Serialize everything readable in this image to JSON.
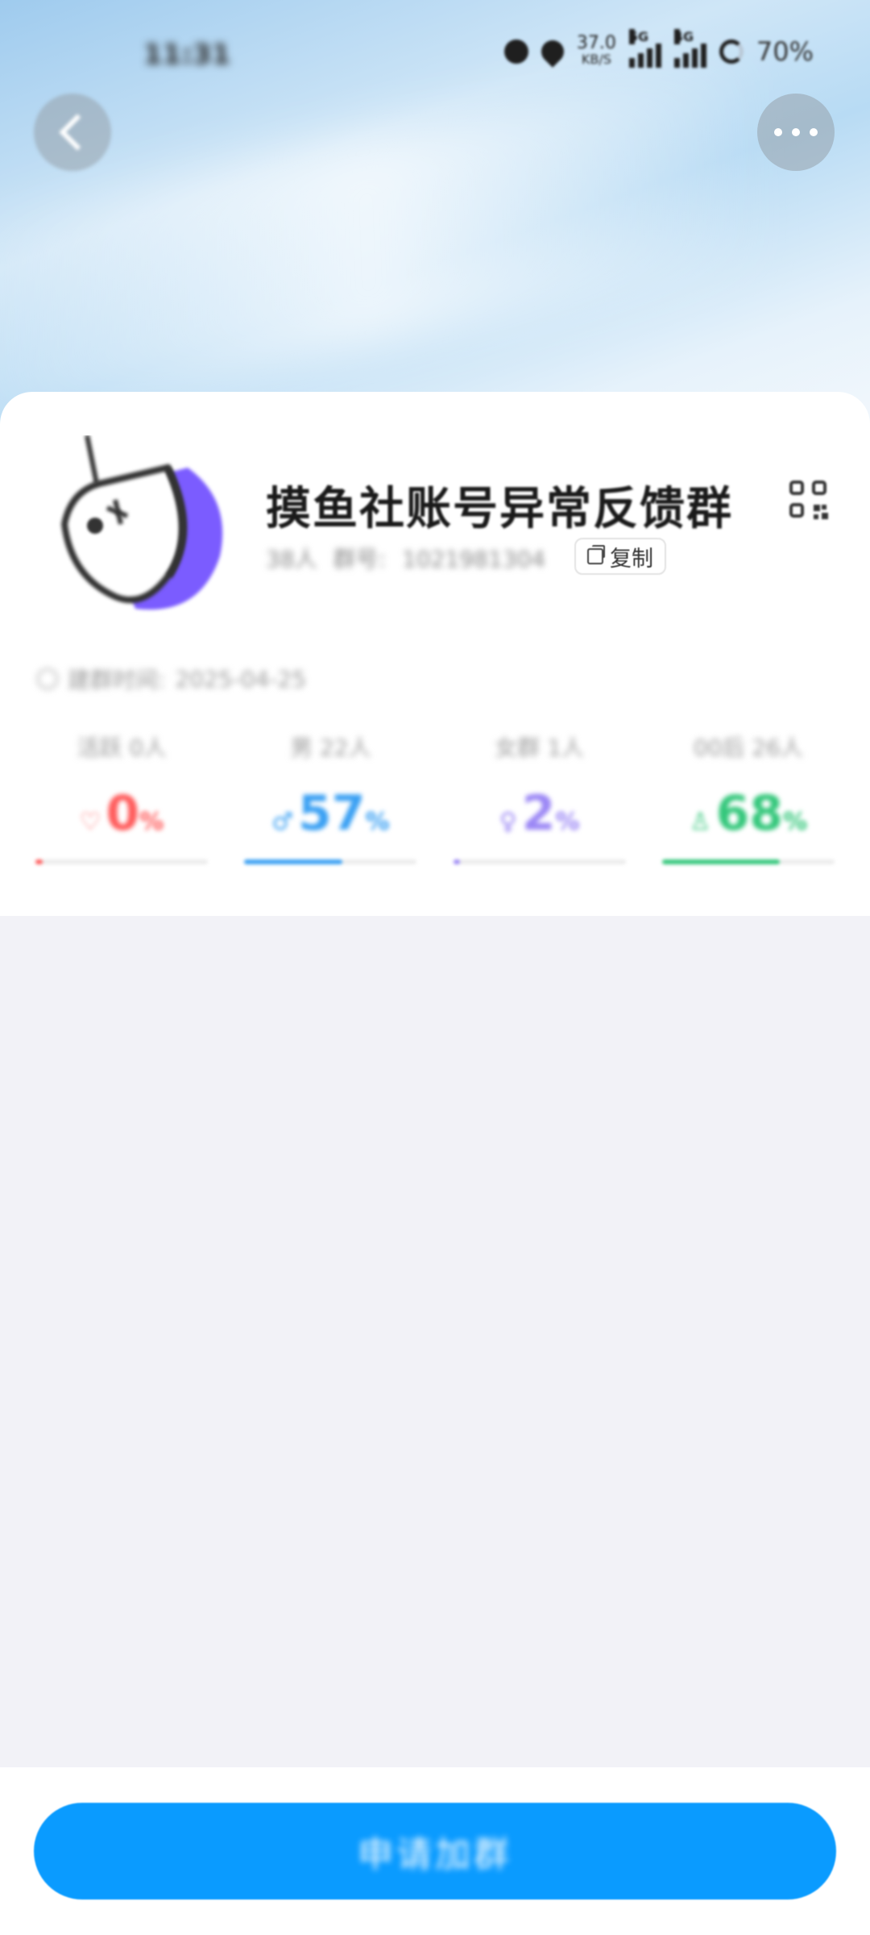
{
  "status_bar": {
    "time": "11:31",
    "net_speed_value": "37.0",
    "net_speed_unit": "KB/S",
    "signal_1_tag": "5G",
    "signal_2_tag": "4G",
    "battery": "70%"
  },
  "group": {
    "name": "摸鱼社账号异常反馈群",
    "members": "38人",
    "id_label": "群号:",
    "id_value": "1021981304",
    "copy_label": "复制",
    "founded_label": "建群时间:",
    "founded_date": "2025-04-25"
  },
  "stats": [
    {
      "label": "活跃 0人",
      "symbol": "♡",
      "value": "0",
      "unit": "%",
      "color": "#ff5c5c",
      "fill": 0
    },
    {
      "label": "男 22人",
      "symbol": "♂",
      "value": "57",
      "unit": "%",
      "color": "#3aa0f3",
      "fill": 57
    },
    {
      "label": "女群 1人",
      "symbol": "♀",
      "value": "2",
      "unit": "%",
      "color": "#9b87f5",
      "fill": 2
    },
    {
      "label": "00后 26人",
      "symbol": "♙",
      "value": "68",
      "unit": "%",
      "color": "#34c77b",
      "fill": 68
    }
  ],
  "actions": {
    "join_label": "申请加群"
  },
  "colors": {
    "primary": "#0a9bff",
    "avatar_purple": "#7b5cff"
  }
}
